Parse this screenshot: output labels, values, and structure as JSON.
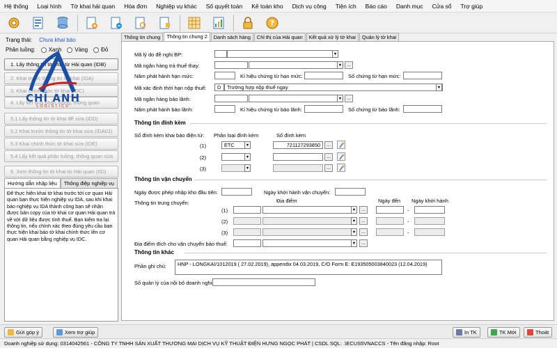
{
  "menu": [
    "Hệ thống",
    "Loại hình",
    "Tờ khai hải quan",
    "Hóa đơn",
    "Nghiệp vụ khác",
    "Số quyết toán",
    "Kế toán kho",
    "Dịch vụ công",
    "Tiện ích",
    "Báo cáo",
    "Danh mục",
    "Cửa sổ",
    "Trợ giúp"
  ],
  "toolbar_icons": [
    "settings-icon",
    "document-stack-icon",
    "database-icon",
    "doc-add-icon",
    "doc-add-icon",
    "doc-search-icon",
    "doc-edit-icon",
    "grid-icon",
    "chart-icon",
    "lock-icon",
    "help-icon"
  ],
  "logo": {
    "title": "CHÍ ANH",
    "subtitle": "LOGISTICS"
  },
  "left": {
    "status_label": "Trạng thái:",
    "status_value": "Chưa khai báo",
    "route_label": "Phân luồng:",
    "route_options": [
      "Xanh",
      "Vàng",
      "Đỏ"
    ],
    "steps": [
      "1. Lấy thông tin tờ khai từ Hải quan (IDB)",
      "2. Khai trước thông tin tờ khai (IDA)",
      "3. Khai chính thức tờ khai (IDC)",
      "4. Lấy kết quả phân luồng, thông quan",
      "5.1 Lấy thông tin tờ khai để sửa (IDD)",
      "5.2 Khai trước thông tin tờ khai sửa (IDA01)",
      "5.3 Khai chính thức tờ khai sửa (IDE)",
      "5.4 Lấy kết quả phân luồng, thông quan sửa",
      "6. Xem thông tin tờ khai từ Hải quan (IID)"
    ],
    "guide_tabs": [
      "Hướng dẫn nhập liệu",
      "Thông điệp nghiệp vụ"
    ],
    "guide_text": "Để thực hiện khai tờ khai trước tới cơ quan Hải quan bạn thực hiện nghiệp vụ IDA, sau khi khai báo nghiệp vụ IDA thành công bạn sẽ nhận được bản copy của tờ khai cơ quan Hải quan trả về với dữ liệu được tính thuế. Bạn kiểm tra lại thông tin, nếu chính xác theo đúng yêu cầu bạn thực hiện khai báo tờ khai chính thức lên cơ quan Hải quan bằng nghiệp vụ IDC."
  },
  "tabs": [
    "Thông tin chung",
    "Thông tin chung 2",
    "Danh sách hàng",
    "Chỉ thị của Hải quan",
    "Kết quả xử lý tờ khai",
    "Quản lý tờ khai"
  ],
  "form": {
    "reason_label": "Mã lý do đề nghị BP:",
    "bank_pay_label": "Mã ngân hàng trả thuế thay:",
    "limit_year_label": "Năm phát hành hạn mức:",
    "limit_symbol_label": "Kí hiệu chứng từ hạn mức:",
    "limit_number_label": "Số chứng từ hạn mức:",
    "tax_due_label": "Mã xác định thời hạn nộp thuế:",
    "tax_due_code": "D",
    "tax_due_desc": "Trường hợp nộp thuế ngay",
    "guarantee_bank_label": "Mã ngân hàng bảo lãnh:",
    "guarantee_year_label": "Năm phát hành bảo lãnh:",
    "guarantee_symbol_label": "Kí hiệu chứng từ bảo lãnh:",
    "guarantee_number_label": "Số chứng từ bảo lãnh:",
    "attach_section": "Thông tin đính kèm",
    "attach_count_label": "Số đính kèm khai báo điện tử:",
    "attach_type_header": "Phân loại đính kèm",
    "attach_number_header": "Số đính kèm",
    "attach_rows": [
      {
        "idx": "(1)",
        "type": "ETC",
        "number": "721127293850"
      },
      {
        "idx": "(2)",
        "type": "",
        "number": ""
      },
      {
        "idx": "(3)",
        "type": "",
        "number": ""
      }
    ],
    "transport_section": "Thông tin vận chuyển",
    "bonded_date_label": "Ngày được phép nhập kho đầu tiên:",
    "depart_date_label": "Ngày khởi hành vận chuyển:",
    "transit_label": "Thông tin trung chuyển:",
    "place_header": "Địa điểm",
    "arrive_header": "Ngày đến",
    "depart_header": "Ngày khởi hành",
    "transit_rows": [
      "(1)",
      "(2)",
      "(3)"
    ],
    "destination_label": "Địa điểm đích cho vận chuyển bảo thuế:",
    "other_section": "Thông tin khác",
    "note_label": "Phần ghi chú:",
    "note_value": "HNP - LONGKAI/1012019 ( 27.02.2019), appendix 04.03.2019, C/O Form E: E193505003840023 (12.04.2019)",
    "internal_mgmt_label": "Số quản lý của nội bộ doanh nghiệp:"
  },
  "bottom": {
    "feedback": "Gửi góp ý",
    "help": "Xem trợ giúp",
    "print": "In TK",
    "new": "TK Mới",
    "close": "Thoát"
  },
  "statusbar": "Doanh nghiệp sử dụng: 0314042561 - CÔNG TY TNHH SẢN XUẤT THƯƠNG MẠI DỊCH VỤ KỸ THUẬT ĐIỆN HƯNG NGỌC PHÁT | CSDL SQL: .\\ECUS5VNACCS - Tên đăng nhập: Root"
}
